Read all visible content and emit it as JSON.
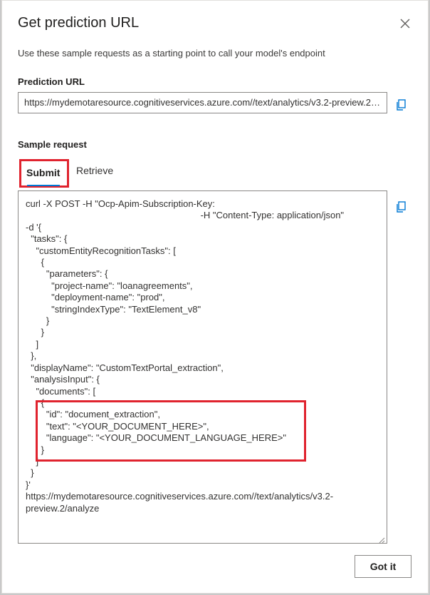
{
  "dialog": {
    "title": "Get prediction URL",
    "subtitle": "Use these sample requests as a starting point to call your model's endpoint"
  },
  "prediction_url": {
    "label": "Prediction URL",
    "value": "https://mydemotaresource.cognitiveservices.azure.com//text/analytics/v3.2-preview.2/analyze"
  },
  "sample_request": {
    "label": "Sample request",
    "tabs": [
      {
        "label": "Submit",
        "selected": true
      },
      {
        "label": "Retrieve",
        "selected": false
      }
    ],
    "code": "curl -X POST -H \"Ocp-Apim-Subscription-Key:\n                                                                    -H \"Content-Type: application/json\"\n-d '{\n  \"tasks\": {\n    \"customEntityRecognitionTasks\": [\n      {\n        \"parameters\": {\n          \"project-name\": \"loanagreements\",\n          \"deployment-name\": \"prod\",\n          \"stringIndexType\": \"TextElement_v8\"\n        }\n      }\n    ]\n  },\n  \"displayName\": \"CustomTextPortal_extraction\",\n  \"analysisInput\": {\n    \"documents\": [\n      {\n        \"id\": \"document_extraction\",\n        \"text\": \"<YOUR_DOCUMENT_HERE>\",\n        \"language\": \"<YOUR_DOCUMENT_LANGUAGE_HERE>\"\n      }\n    ]\n  }\n}'\nhttps://mydemotaresource.cognitiveservices.azure.com//text/analytics/v3.2-\npreview.2/analyze"
  },
  "footer": {
    "got_it_label": "Got it"
  },
  "icons": {
    "close": "close-icon",
    "copy": "copy-icon"
  },
  "colors": {
    "accent": "#0078d4",
    "highlight": "#e0232e"
  }
}
